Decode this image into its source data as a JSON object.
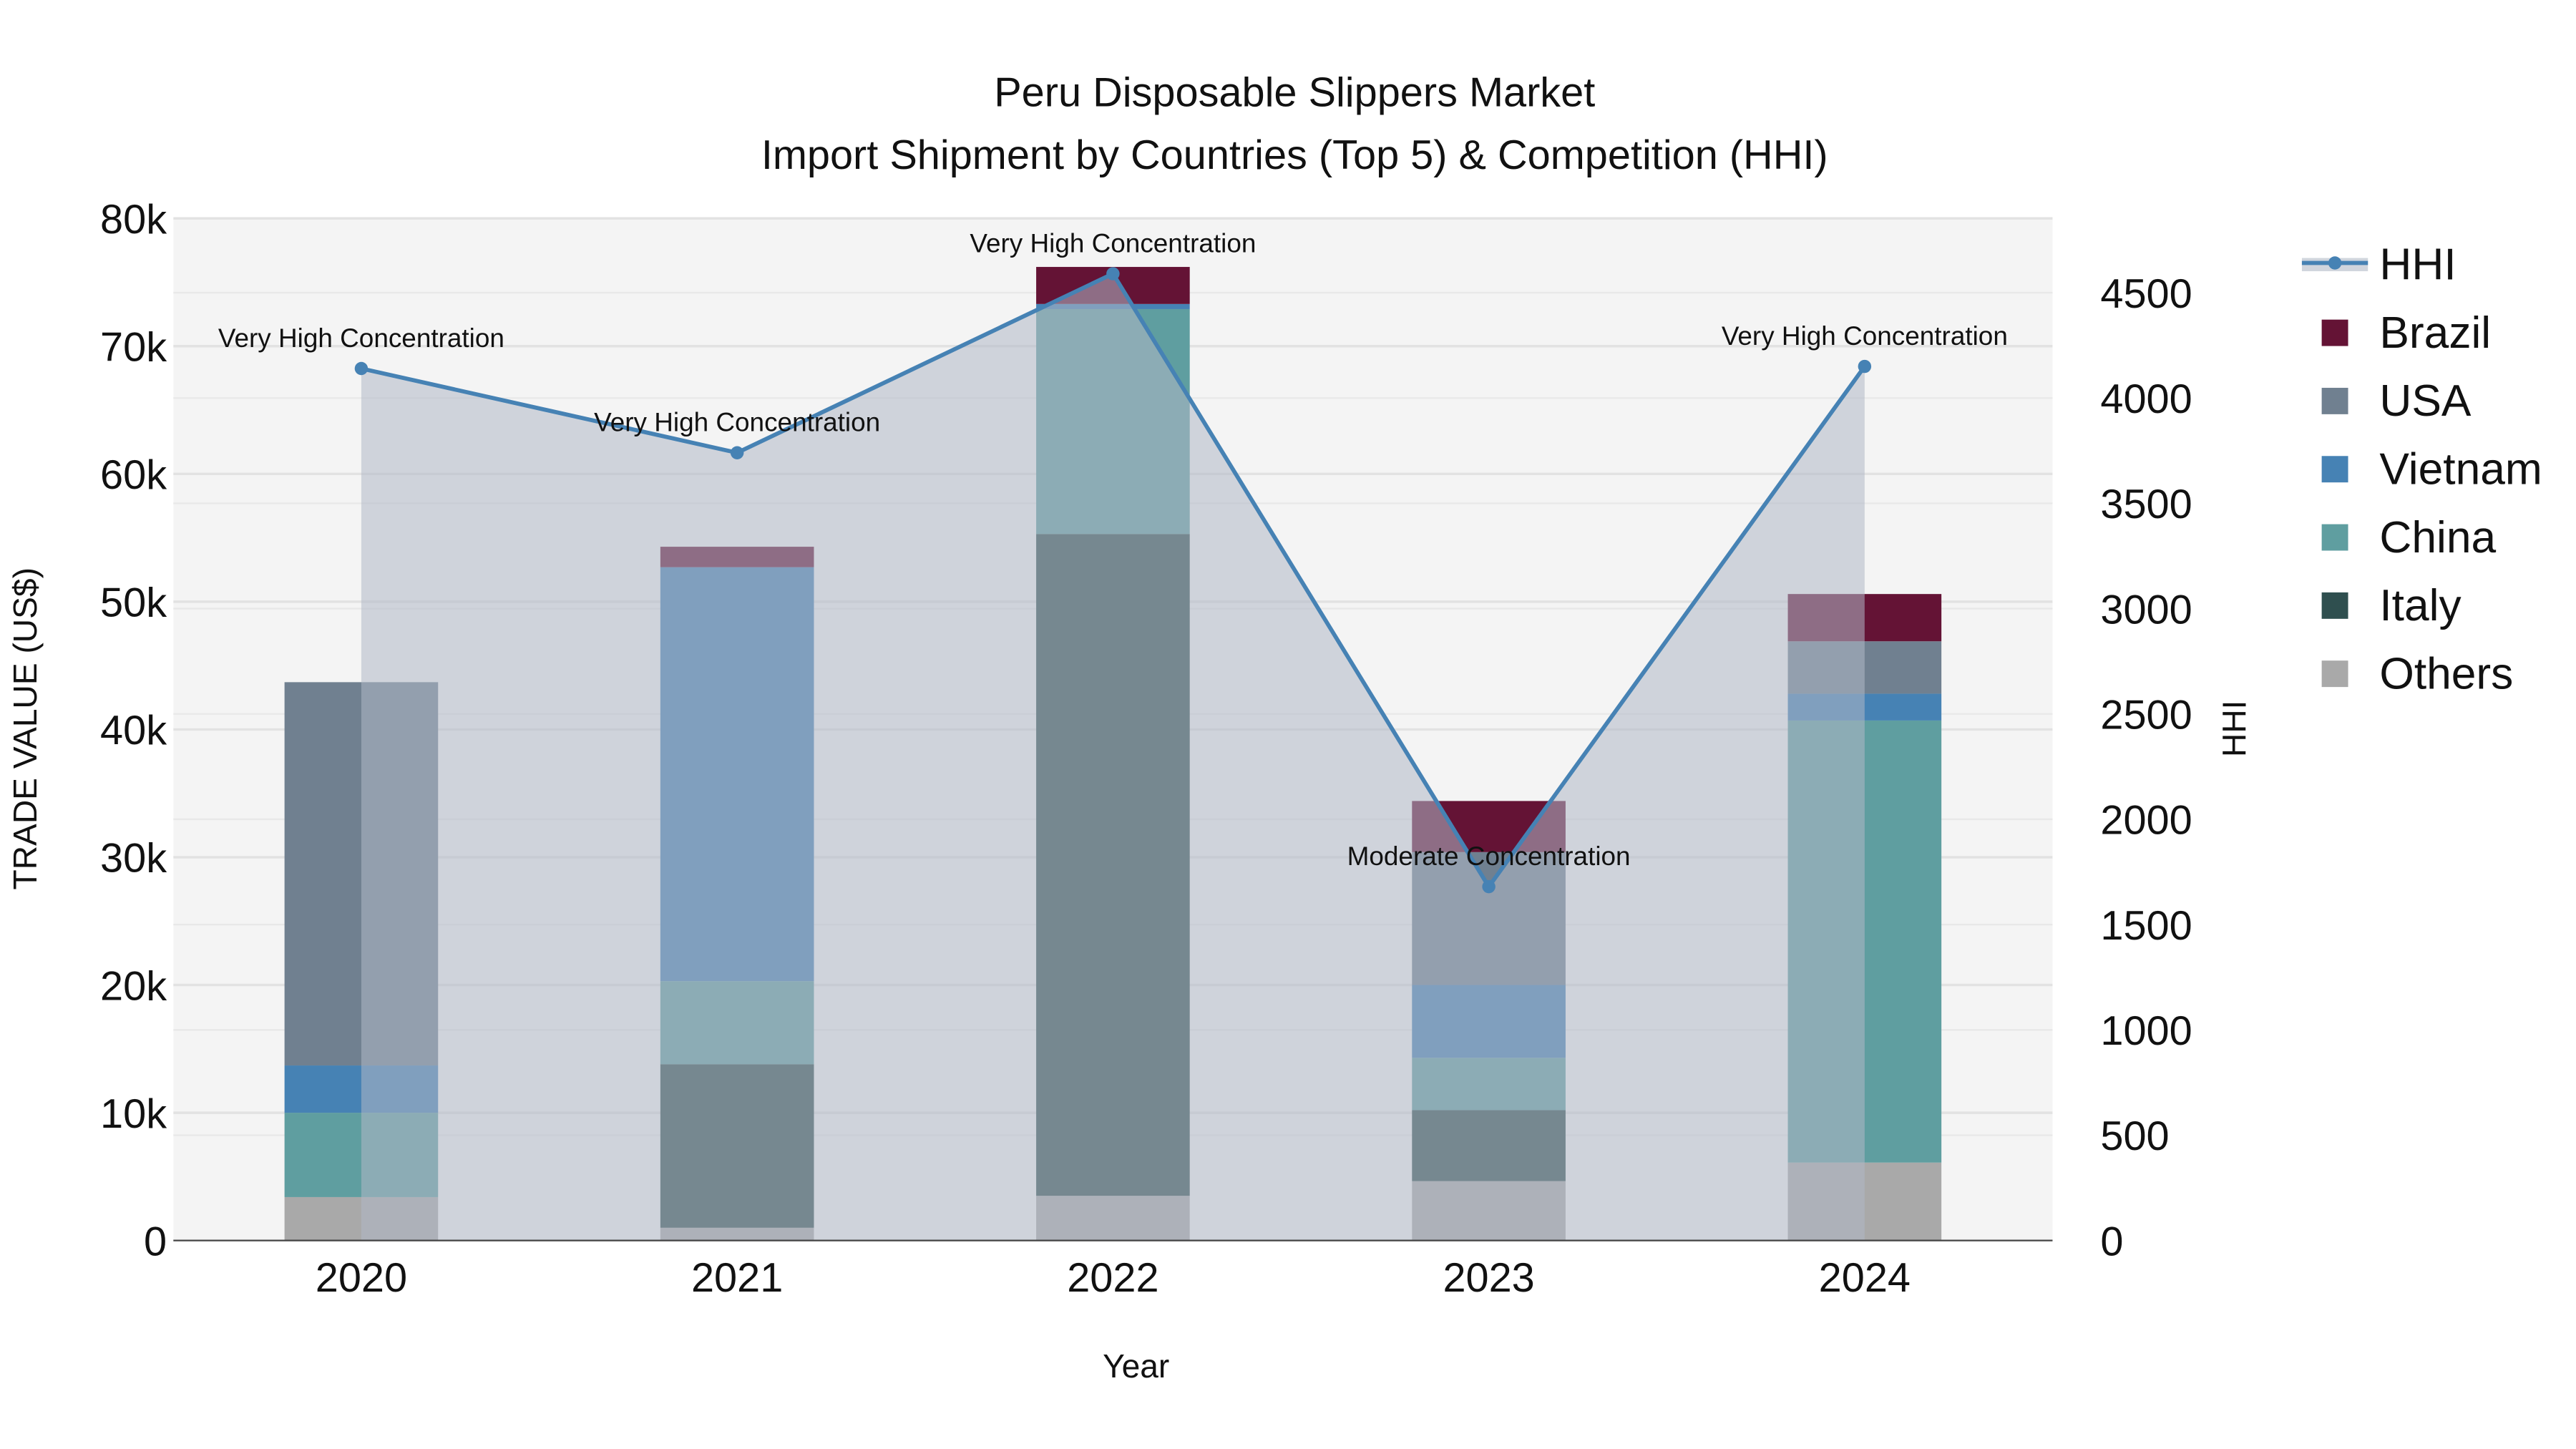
{
  "chart_data": {
    "type": "bar",
    "stacked": true,
    "title": "Peru Disposable Slippers Market",
    "subtitle": "Import Shipment by Countries (Top 5) & Competition (HHI)",
    "xlabel": "Year",
    "ylabel": "TRADE VALUE (US$)",
    "y2label": "HHI",
    "categories": [
      "2020",
      "2021",
      "2022",
      "2023",
      "2024"
    ],
    "ylim": [
      0,
      80000
    ],
    "y2lim": [
      0,
      4850
    ],
    "yticks": [
      0,
      10000,
      20000,
      30000,
      40000,
      50000,
      60000,
      70000,
      80000
    ],
    "ytick_labels": [
      "0",
      "10k",
      "20k",
      "30k",
      "40k",
      "50k",
      "60k",
      "70k",
      "80k"
    ],
    "y2ticks": [
      0,
      500,
      1000,
      1500,
      2000,
      2500,
      3000,
      3500,
      4000,
      4500
    ],
    "y2tick_labels": [
      "0",
      "500",
      "1000",
      "1500",
      "2000",
      "2500",
      "3000",
      "3500",
      "4000",
      "4500"
    ],
    "grid": true,
    "legend_position": "right",
    "series": [
      {
        "name": "Others",
        "color": "#a9a9a9",
        "values": [
          3400,
          1000,
          3500,
          4650,
          6100
        ]
      },
      {
        "name": "Italy",
        "color": "#2f4f4f",
        "values": [
          0,
          12800,
          51800,
          5550,
          0
        ]
      },
      {
        "name": "China",
        "color": "#5f9ea0",
        "values": [
          6600,
          6500,
          17600,
          4100,
          34600
        ]
      },
      {
        "name": "Vietnam",
        "color": "#4682b4",
        "values": [
          3700,
          32400,
          400,
          5700,
          2100
        ]
      },
      {
        "name": "USA",
        "color": "#708090",
        "values": [
          30000,
          0,
          0,
          10400,
          4100
        ]
      },
      {
        "name": "Brazil",
        "color": "#641335",
        "values": [
          0,
          1600,
          2900,
          4000,
          3700
        ]
      }
    ],
    "hhi": {
      "name": "HHI",
      "color": "#4682b4",
      "values": [
        4140,
        3740,
        4590,
        1680,
        4150
      ],
      "annotations": [
        "Very High Concentration",
        "Very High Concentration",
        "Very High Concentration",
        "Moderate Concentration",
        "Very High Concentration"
      ]
    },
    "legend": [
      "HHI",
      "Brazil",
      "USA",
      "Vietnam",
      "China",
      "Italy",
      "Others"
    ]
  }
}
